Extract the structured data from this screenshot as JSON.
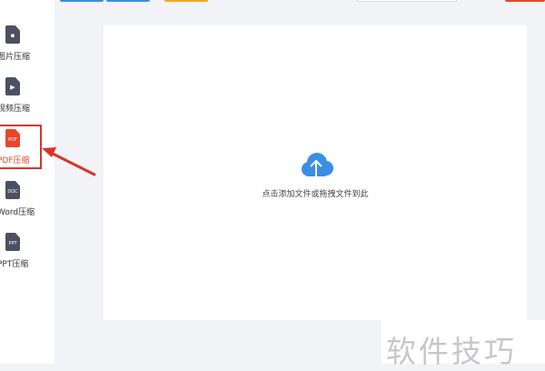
{
  "sidebar": {
    "items": [
      {
        "label": "图片压缩",
        "icon": "image-file-icon",
        "glyph": "▪"
      },
      {
        "label": "视频压缩",
        "icon": "video-file-icon",
        "glyph": "▶"
      },
      {
        "label": "PDF压缩",
        "icon": "pdf-file-icon",
        "tag": "PDF",
        "active": true
      },
      {
        "label": "Word压缩",
        "icon": "doc-file-icon",
        "tag": "DOC"
      },
      {
        "label": "PPT压缩",
        "icon": "ppt-file-icon",
        "tag": "PPT"
      }
    ]
  },
  "upload": {
    "hint": "点击添加文件或拖拽文件到此",
    "icon": "cloud-upload-icon"
  },
  "watermark": {
    "text": "软件技巧"
  },
  "colors": {
    "accent": "#e8472a",
    "primary_blue": "#3a8ee6",
    "orange": "#f5a623",
    "red_button": "#e8472a",
    "annotation_red": "#d9342b",
    "icon_dark": "#4b5063"
  }
}
